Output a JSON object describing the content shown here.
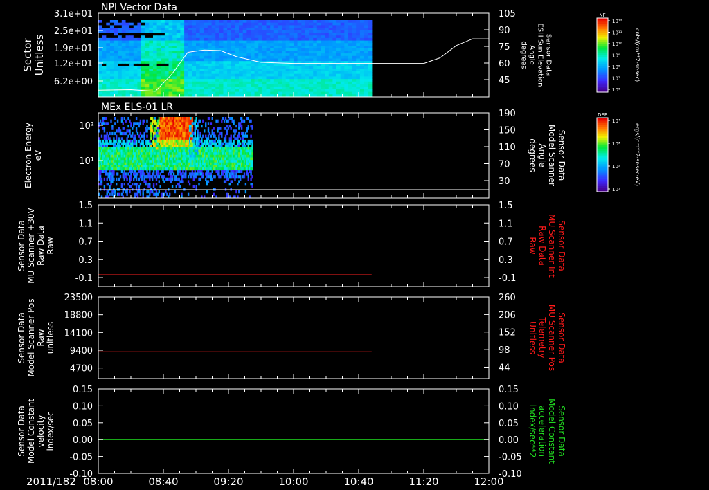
{
  "colors": {
    "background": "#000000",
    "foreground": "#ffffff",
    "red_trace": "#ff2020",
    "green_trace": "#20e020",
    "red_label": "#ff1a1a",
    "green_label": "#22dd22"
  },
  "time_axis": {
    "date_label": "2011/182",
    "ticks": [
      "08:00",
      "08:40",
      "09:20",
      "10:00",
      "10:40",
      "11:20",
      "12:00"
    ]
  },
  "colorbars": [
    {
      "name": "nf-colorbar",
      "title": "NF",
      "unit": "cnts/(cm**2-sr-sec)",
      "tick_labels": [
        "10¹²",
        "10¹¹",
        "10¹⁰",
        "10⁹",
        "10⁸",
        "10⁷",
        "10⁶"
      ]
    },
    {
      "name": "def-colorbar",
      "title": "DEF",
      "unit": "ergs/(cm**2-sr-sec-eV)",
      "tick_labels": [
        "10⁴",
        "10³",
        "10²",
        "10¹"
      ]
    }
  ],
  "chart_data": [
    {
      "type": "heatmap",
      "title": "NPI Vector Data",
      "ylabel": [
        "Sector",
        "Unitless"
      ],
      "y_ticks": [
        "3.1e+01",
        "2.5e+01",
        "1.9e+01",
        "1.2e+01",
        "6.2e+00"
      ],
      "ylabel_right": [
        "Sensor Data",
        "ESH Sun Elevation",
        "Angle",
        "degrees"
      ],
      "y_right_ticks": [
        "105",
        "90",
        "75",
        "60",
        "45"
      ],
      "y_right_range": [
        30,
        105
      ],
      "data_end_time": "10:48",
      "overlay_line": {
        "name": "ESH Sun Elevation Angle",
        "x": [
          "08:00",
          "08:20",
          "08:35",
          "08:45",
          "08:55",
          "09:05",
          "09:15",
          "09:25",
          "09:40",
          "10:00",
          "10:40",
          "11:20",
          "11:30",
          "11:40",
          "11:50",
          "12:00"
        ],
        "y": [
          36,
          36.5,
          35,
          50,
          70,
          72,
          71.5,
          66,
          61,
          60,
          60,
          60,
          65,
          76,
          82,
          82
        ]
      }
    },
    {
      "type": "heatmap",
      "title": "MEx ELS-01 LR",
      "ylabel": [
        "Electron Energy",
        "eV"
      ],
      "y_ticks": [
        "10²",
        "10¹"
      ],
      "y_log": true,
      "y_range_eV": [
        1.5,
        200
      ],
      "ylabel_right": [
        "Sensor Data",
        "Model Scanner",
        "Angle",
        "degrees"
      ],
      "y_right_ticks": [
        "190",
        "150",
        "110",
        "70",
        "30"
      ],
      "y_right_range": [
        10,
        190
      ],
      "data_end_time": "09:35",
      "overlay_line": {
        "name": "Model Scanner Angle",
        "x": [
          "08:00",
          "12:00"
        ],
        "y": [
          10,
          10
        ]
      }
    },
    {
      "type": "line",
      "ylabel": [
        "Sensor Data",
        "MU Scanner +30V",
        "Raw Data",
        "Raw"
      ],
      "y_ticks": [
        "1.5",
        "1.1",
        "0.7",
        "0.3",
        "-0.1"
      ],
      "ylim": [
        -0.3,
        1.5
      ],
      "ylabel_right": [
        "Sensor Data",
        "MU Scanner Int",
        "Raw Data",
        "Raw"
      ],
      "y_right_ticks": [
        "1.5",
        "1.1",
        "0.7",
        "0.3",
        "-0.1"
      ],
      "series": [
        {
          "x": [
            "08:00",
            "10:48"
          ],
          "y": [
            -0.04,
            -0.04
          ]
        }
      ]
    },
    {
      "type": "line",
      "ylabel": [
        "Sensor Data",
        "Model Scanner Pos",
        "Raw",
        "unitless"
      ],
      "y_ticks": [
        "23500",
        "18800",
        "14100",
        "9400",
        "4700"
      ],
      "ylim": [
        0,
        23500
      ],
      "ylabel_right": [
        "Sensor Data",
        "MU Scanner Pos",
        "Telemetry",
        "Unitless"
      ],
      "y_right_ticks": [
        "260",
        "206",
        "152",
        "98",
        "44"
      ],
      "series": [
        {
          "x": [
            "08:00",
            "10:48"
          ],
          "y": [
            7700,
            7700
          ]
        }
      ]
    },
    {
      "type": "line",
      "ylabel": [
        "Sensor Data",
        "Model Constant",
        "velocity",
        "index/sec"
      ],
      "y_ticks": [
        "0.15",
        "0.10",
        "0.05",
        "0.00",
        "-0.05",
        "-0.10"
      ],
      "ylim": [
        -0.1,
        0.15
      ],
      "ylabel_right": [
        "Sensor Data",
        "Model Constant",
        "acceleration",
        "index/sec**2"
      ],
      "y_right_ticks": [
        "0.15",
        "0.10",
        "0.05",
        "0.00",
        "-0.05",
        "-0.10"
      ],
      "series": [
        {
          "x": [
            "08:00",
            "12:00"
          ],
          "y": [
            0,
            0
          ]
        }
      ]
    }
  ]
}
